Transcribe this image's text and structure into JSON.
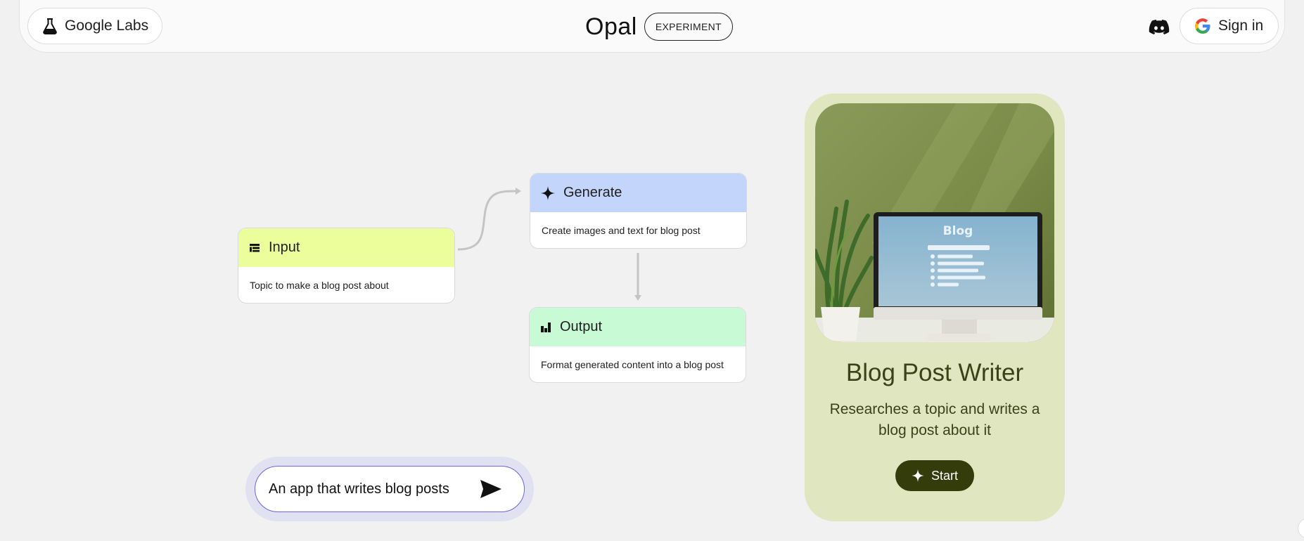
{
  "header": {
    "labs_label": "Google Labs",
    "brand_name": "Opal",
    "badge_label": "EXPERIMENT",
    "signin_label": "Sign in"
  },
  "flow": {
    "input": {
      "title": "Input",
      "description": "Topic to make a blog post about",
      "icon": "input-lines-icon",
      "color": "#ecfe9b"
    },
    "generate": {
      "title": "Generate",
      "description": "Create images and text for blog post",
      "icon": "sparkle-icon",
      "color": "#c3d5fb"
    },
    "output": {
      "title": "Output",
      "description": "Format generated content into a blog post",
      "icon": "output-bars-icon",
      "color": "#c8fad5"
    }
  },
  "prompt": {
    "value": "An app that writes blog posts",
    "icon": "send-icon"
  },
  "card": {
    "image_text": "Blog",
    "title": "Blog Post Writer",
    "description": "Researches a topic and writes a blog post about it",
    "start_label": "Start"
  },
  "colors": {
    "background": "#f1f1f1",
    "card": "#e0e6c0",
    "start_button": "#343c0c",
    "prompt_border": "#6b66d6"
  }
}
